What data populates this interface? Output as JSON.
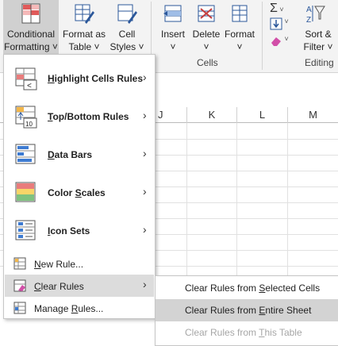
{
  "ribbon": {
    "buttons": [
      {
        "id": "conditional-formatting",
        "line1": "Conditional",
        "line2": "Formatting ˅",
        "active": true
      },
      {
        "id": "format-as-table",
        "line1": "Format as",
        "line2": "Table ˅"
      },
      {
        "id": "cell-styles",
        "line1": "Cell",
        "line2": "Styles ˅"
      },
      {
        "id": "insert",
        "line1": "Insert",
        "line2": "˅"
      },
      {
        "id": "delete",
        "line1": "Delete",
        "line2": "˅"
      },
      {
        "id": "format",
        "line1": "Format",
        "line2": "˅"
      },
      {
        "id": "sort-filter",
        "line1": "Sort &",
        "line2": "Filter ˅"
      }
    ],
    "groups": {
      "cells": "Cells",
      "editing": "Editing"
    }
  },
  "sheet": {
    "columns": [
      "J",
      "K",
      "L",
      "M"
    ]
  },
  "menu": {
    "items": [
      {
        "label": "Highlight Cells Rules",
        "mnemonic": "H",
        "rest": "ighlight Cells Rules"
      },
      {
        "label": "Top/Bottom Rules",
        "mnemonic": "T",
        "rest": "op/Bottom Rules"
      },
      {
        "label": "Data Bars",
        "mnemonic": "D",
        "rest": "ata Bars"
      },
      {
        "label": "Color Scales",
        "pre": "Color ",
        "mnemonic": "S",
        "rest": "cales"
      },
      {
        "label": "Icon Sets",
        "mnemonic": "I",
        "rest": "con Sets"
      },
      {
        "label": "New Rule...",
        "mnemonic": "N",
        "rest": "ew Rule..."
      },
      {
        "label": "Clear Rules",
        "mnemonic": "C",
        "rest": "lear Rules"
      },
      {
        "label": "Manage Rules...",
        "pre": "Manage ",
        "mnemonic": "R",
        "rest": "ules..."
      }
    ]
  },
  "submenu": {
    "items": [
      {
        "pre": "Clear Rules from ",
        "mnemonic": "S",
        "rest": "elected Cells"
      },
      {
        "pre": "Clear Rules from ",
        "mnemonic": "E",
        "rest": "ntire Sheet"
      },
      {
        "pre": "Clear Rules from ",
        "mnemonic": "T",
        "rest": "his Table"
      }
    ]
  },
  "colors": {
    "accent": "#2b579a",
    "red": "#c43e3e",
    "highlight": "#d3d3d3"
  }
}
